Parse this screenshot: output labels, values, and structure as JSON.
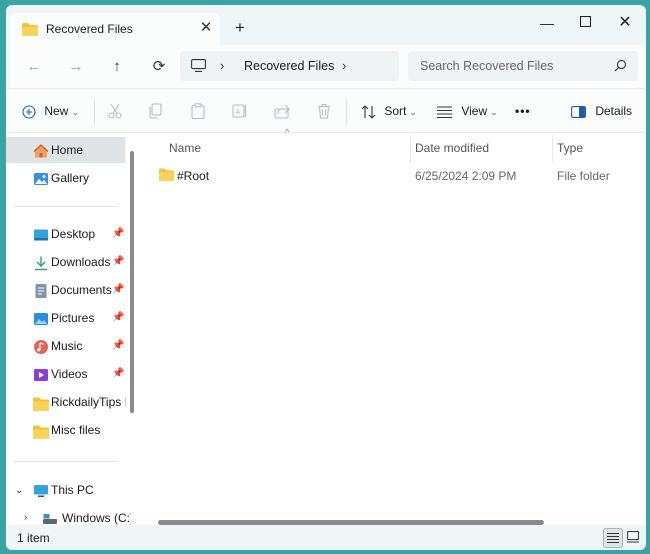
{
  "tab": {
    "title": "Recovered Files"
  },
  "window": {
    "minimize": "—",
    "maximize": "□",
    "close": "✕"
  },
  "nav": {
    "back": "←",
    "forward": "→",
    "up": "↑",
    "refresh": "⟳",
    "breadcrumb": [
      "Recovered Files"
    ],
    "search_placeholder": "Search Recovered Files"
  },
  "commands": {
    "new_label": "New",
    "sort_label": "Sort",
    "view_label": "View",
    "more_label": "•••",
    "details_label": "Details"
  },
  "sidebar": {
    "top": [
      {
        "label": "Home",
        "icon": "home-icon",
        "active": true
      },
      {
        "label": "Gallery",
        "icon": "gallery-icon"
      }
    ],
    "quick": [
      {
        "label": "Desktop",
        "icon": "desktop-icon"
      },
      {
        "label": "Downloads",
        "icon": "downloads-icon"
      },
      {
        "label": "Documents",
        "icon": "documents-icon"
      },
      {
        "label": "Pictures",
        "icon": "pictures-icon"
      },
      {
        "label": "Music",
        "icon": "music-icon"
      },
      {
        "label": "Videos",
        "icon": "videos-icon"
      },
      {
        "label": "RickdailyTips Im",
        "icon": "folder-icon"
      },
      {
        "label": "Misc files",
        "icon": "folder-icon"
      }
    ],
    "this_pc": "This PC",
    "drive": "Windows (C:)"
  },
  "columns": {
    "name": "Name",
    "date": "Date modified",
    "type": "Type"
  },
  "files": [
    {
      "name": "#Root",
      "date": "6/25/2024 2:09 PM",
      "type": "File folder"
    }
  ],
  "status": {
    "count": "1 item"
  },
  "colors": {
    "accent": "#3aa3a3",
    "folder": "#f3c33b"
  }
}
